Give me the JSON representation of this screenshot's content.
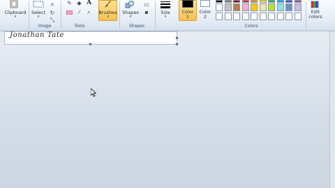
{
  "ribbon": {
    "clipboard_label": "Clipboard",
    "select_label": "Select",
    "image_group": "Image",
    "tools_group": "Tools",
    "brushes_label": "Brushes",
    "shapes_label": "Shapes",
    "shapes_group": "Shapes",
    "size_label": "Size",
    "color1_label_line1": "Color",
    "color1_label_line2": "1",
    "color2_label_line1": "Color",
    "color2_label_line2": "2",
    "colors_group": "Colors",
    "edit_colors_line1": "Edit",
    "edit_colors_line2": "colors",
    "text_tool_glyph": "A"
  },
  "palette": {
    "row1": [
      "#000000",
      "#7f7f7f",
      "#880015",
      "#ed1c24",
      "#ff7f27",
      "#fff200",
      "#22b14c",
      "#00a2e8",
      "#3f48cc",
      "#a349a4"
    ],
    "row2": [
      "#ffffff",
      "#c3c3c3",
      "#b97a57",
      "#ffaec9",
      "#ffc90e",
      "#efe4b0",
      "#b5e61d",
      "#99d9ea",
      "#7092be",
      "#c8bfe7"
    ],
    "row3": [
      "#ffffff",
      "#ffffff",
      "#ffffff",
      "#ffffff",
      "#ffffff",
      "#ffffff",
      "#ffffff",
      "#ffffff",
      "#ffffff",
      "#ffffff"
    ],
    "color1": "#000000",
    "color2": "#ffffff"
  },
  "canvas": {
    "signature_text": "Jonathan Tate"
  }
}
